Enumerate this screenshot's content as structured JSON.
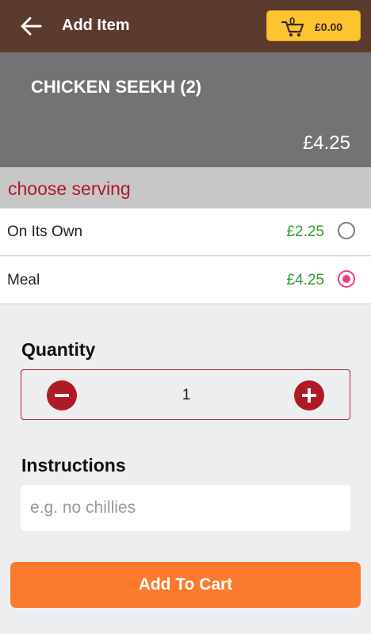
{
  "header": {
    "title": "Add Item",
    "cart": {
      "count": "0",
      "total": "£0.00"
    }
  },
  "item": {
    "name": "CHICKEN SEEKH (2)",
    "price": "£4.25"
  },
  "serving": {
    "title": "choose serving",
    "options": [
      {
        "label": "On Its Own",
        "price": "£2.25",
        "selected": false
      },
      {
        "label": "Meal",
        "price": "£4.25",
        "selected": true
      }
    ]
  },
  "quantity": {
    "label": "Quantity",
    "value": "1"
  },
  "instructions": {
    "label": "Instructions",
    "placeholder": "e.g. no chillies",
    "value": ""
  },
  "add_button": {
    "label": "Add To Cart"
  },
  "icons": {
    "back": "arrow-left-icon",
    "cart": "shopping-cart-icon",
    "minus": "minus-circle-icon",
    "plus": "plus-circle-icon"
  },
  "colors": {
    "topbar": "#5a3b2e",
    "cart_button": "#fcc42f",
    "accent_red": "#b01a24",
    "price_green": "#2e9b2e",
    "radio_selected": "#ef3f78",
    "add_button": "#fb7a2d"
  }
}
